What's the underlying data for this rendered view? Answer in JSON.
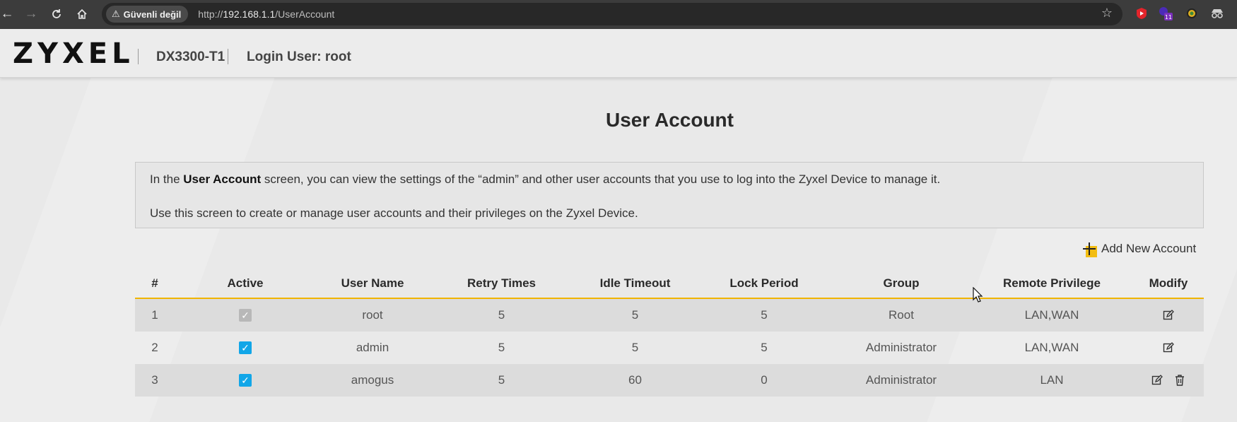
{
  "browser": {
    "security_label": "Güvenli değil",
    "url_scheme": "http://",
    "url_host": "192.168.1.1",
    "url_path": "/UserAccount",
    "extension_badge": "11"
  },
  "header": {
    "logo": "ZYXEL",
    "model": "DX3300-T1",
    "login_user": "Login User: root"
  },
  "page": {
    "title": "User Account",
    "description_prefix": "In the ",
    "description_bold": "User Account",
    "description_rest": " screen, you can view the settings of the “admin” and other user accounts that you use to log into the Zyxel Device to manage it.",
    "description_2": "Use this screen to create or manage user accounts and their privileges on the Zyxel Device.",
    "add_label": "Add New Account"
  },
  "table": {
    "headers": {
      "index": "#",
      "active": "Active",
      "username": "User Name",
      "retry": "Retry Times",
      "idle": "Idle Timeout",
      "lock": "Lock Period",
      "group": "Group",
      "remote": "Remote Privilege",
      "modify": "Modify"
    },
    "rows": [
      {
        "index": "1",
        "active": true,
        "active_editable": false,
        "username": "root",
        "retry": "5",
        "idle": "5",
        "lock": "5",
        "group": "Root",
        "remote": "LAN,WAN",
        "deletable": false
      },
      {
        "index": "2",
        "active": true,
        "active_editable": true,
        "username": "admin",
        "retry": "5",
        "idle": "5",
        "lock": "5",
        "group": "Administrator",
        "remote": "LAN,WAN",
        "deletable": false
      },
      {
        "index": "3",
        "active": true,
        "active_editable": true,
        "username": "amogus",
        "retry": "5",
        "idle": "60",
        "lock": "0",
        "group": "Administrator",
        "remote": "LAN",
        "deletable": true
      }
    ]
  },
  "colors": {
    "accent": "#f0b400",
    "checkbox_active": "#11a6e8",
    "checkbox_disabled": "#b8b8b8"
  }
}
